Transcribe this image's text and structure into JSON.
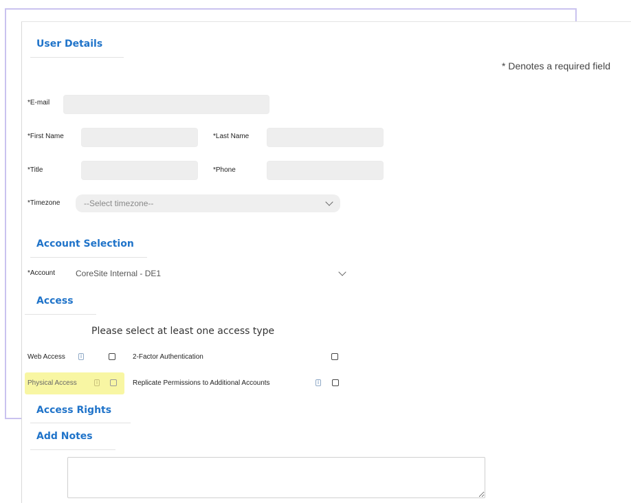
{
  "header": {
    "section_user_details": "User Details",
    "required_note": "* Denotes a required field"
  },
  "form": {
    "email_label": "*E-mail",
    "first_name_label": "*First Name",
    "last_name_label": "*Last Name",
    "title_label": "*Title",
    "phone_label": "*Phone",
    "timezone_label": "*Timezone",
    "timezone_value": "--Select timezone--"
  },
  "account_selection": {
    "heading": "Account Selection",
    "account_label": "*Account",
    "account_value": "CoreSite Internal - DE1"
  },
  "access": {
    "heading": "Access",
    "hint": "Please select at least one access type",
    "web_access_label": "Web Access",
    "two_factor_label": "2-Factor Authentication",
    "physical_access_label": "Physical Access",
    "replicate_label": "Replicate Permissions to Additional Accounts",
    "info_glyph": "i"
  },
  "access_rights": {
    "heading": "Access Rights"
  },
  "notes": {
    "heading": "Add Notes"
  },
  "icons": [
    "info-icon",
    "chevron-down-icon",
    "checkbox"
  ],
  "colors": {
    "accent": "#1f73c9",
    "highlight": "#f8f6a3",
    "frame": "#c9c2ef"
  }
}
